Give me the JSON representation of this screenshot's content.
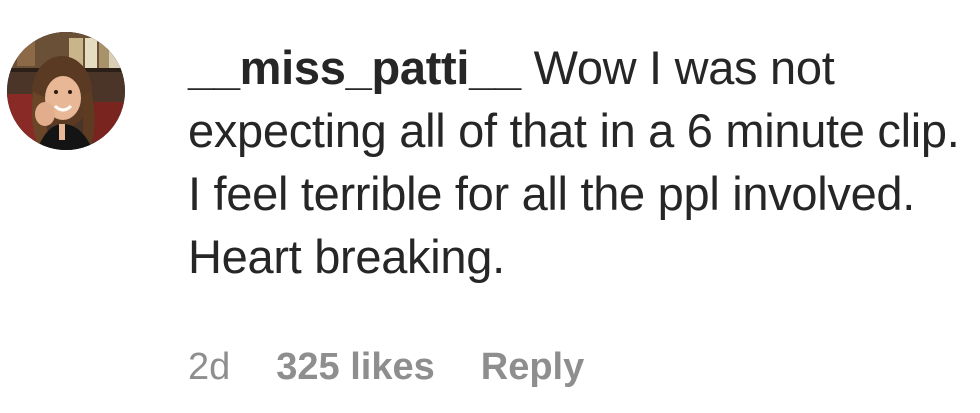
{
  "comment": {
    "username": "__miss_patti__",
    "text": "Wow I was not expecting all of that in a 6 minute clip. I feel terrible for all the ppl involved. Heart breaking.",
    "timestamp": "2d",
    "likes": "325 likes",
    "reply_label": "Reply",
    "avatar_icon": "profile-photo"
  },
  "colors": {
    "text_primary": "#262626",
    "text_secondary": "#8e8e8e",
    "background": "#ffffff"
  }
}
